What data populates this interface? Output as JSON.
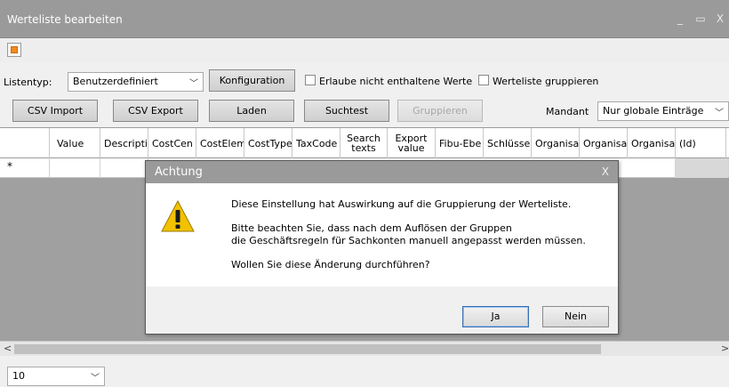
{
  "window": {
    "title": "Werteliste bearbeiten",
    "minimize_glyph": "_",
    "maximize_glyph": "▭",
    "close_glyph": "X"
  },
  "toolbar": {
    "listentyp_label": "Listentyp:",
    "listentyp_value": "Benutzerdefiniert",
    "konfiguration_label": "Konfiguration",
    "erlaube_label": "Erlaube nicht enthaltene Werte",
    "gruppieren_check_label": "Werteliste gruppieren",
    "csv_import_label": "CSV Import",
    "csv_export_label": "CSV Export",
    "laden_label": "Laden",
    "suchtest_label": "Suchtest",
    "gruppieren_label": "Gruppieren",
    "mandant_label": "Mandant",
    "mandant_value": "Nur globale Einträge"
  },
  "grid": {
    "columns": [
      "",
      "Value",
      "Descripti",
      "CostCen",
      "CostElem",
      "CostType",
      "TaxCode",
      "Search texts",
      "Export value",
      "Fibu-Ebe",
      "Schlüsse",
      "Organisa",
      "Organisa",
      "Organisa",
      "(Id)"
    ],
    "new_row_marker": "*"
  },
  "footer": {
    "page_size_value": "10"
  },
  "dialog": {
    "title": "Achtung",
    "close_glyph": "X",
    "line1": "Diese Einstellung hat Auswirkung auf die Gruppierung der Werteliste.",
    "line2": "Bitte beachten Sie, dass nach dem Auflösen der Gruppen",
    "line3": "die Geschäftsregeln für Sachkonten manuell angepasst werden müssen.",
    "line4": "Wollen Sie diese Änderung durchführen?",
    "yes_label": "Ja",
    "no_label": "Nein"
  },
  "colors": {
    "titlebar": "#9a9a9a",
    "grid_background": "#a0a0a0",
    "warning_yellow": "#f2c200"
  }
}
